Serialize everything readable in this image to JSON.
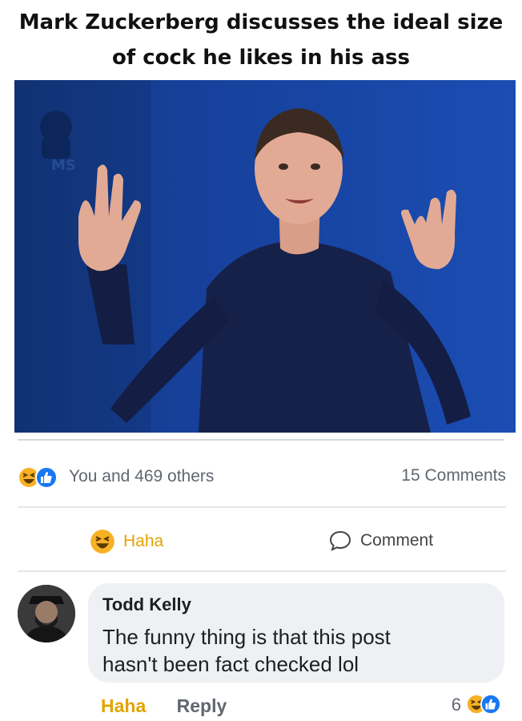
{
  "caption": {
    "line1": "Mark Zuckerberg discusses the ideal size",
    "line2": "of cock he likes in his ass"
  },
  "photo": {
    "watermark": "MS",
    "background_color": "#1a4cb0"
  },
  "post_stats": {
    "reactions_icons": [
      "haha-icon",
      "like-icon"
    ],
    "reactions_text": "You and 469 others",
    "comments_text": "15 Comments"
  },
  "actions": {
    "haha_label": "Haha",
    "comment_label": "Comment"
  },
  "comment": {
    "author": "Todd Kelly",
    "text_line1": "The funny thing is that this post",
    "text_line2": "hasn't been fact checked lol",
    "haha_label": "Haha",
    "reply_label": "Reply",
    "reaction_count": "6"
  },
  "colors": {
    "haha": "#f7b125",
    "like": "#1877f2",
    "haha_text": "#e3a300",
    "muted_text": "#606770",
    "bubble": "#eef0f3"
  }
}
